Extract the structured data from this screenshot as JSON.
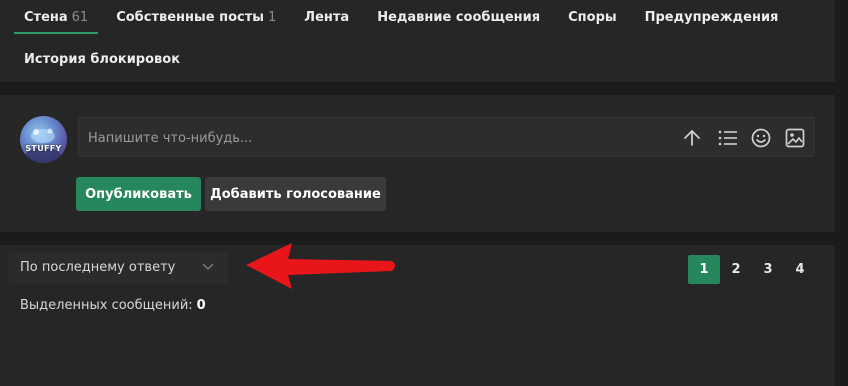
{
  "tabs": {
    "row1": [
      {
        "label": "Стена",
        "count": "61",
        "active": true
      },
      {
        "label": "Собственные посты",
        "count": "1"
      },
      {
        "label": "Лента"
      },
      {
        "label": "Недавние сообщения"
      },
      {
        "label": "Споры"
      },
      {
        "label": "Предупреждения"
      }
    ],
    "row2": [
      {
        "label": "История блокировок"
      }
    ]
  },
  "composer": {
    "avatar_text": "STUFFY",
    "placeholder": "Напишите что-нибудь...",
    "tools": [
      "arrow-up-icon",
      "list-icon",
      "smiley-icon",
      "image-icon"
    ],
    "publish_label": "Опубликовать",
    "poll_label": "Добавить голосование"
  },
  "threads": {
    "sort_label": "По последнему ответу",
    "selected_label": "Выделенных сообщений:",
    "selected_count": "0",
    "pages": [
      "1",
      "2",
      "3",
      "4"
    ],
    "current_page": "1"
  },
  "colors": {
    "accent": "#26875d",
    "tab_underline": "#2e9a6a",
    "annotation": "#e8161a",
    "panel": "#262626",
    "background": "#1b1b1b"
  }
}
